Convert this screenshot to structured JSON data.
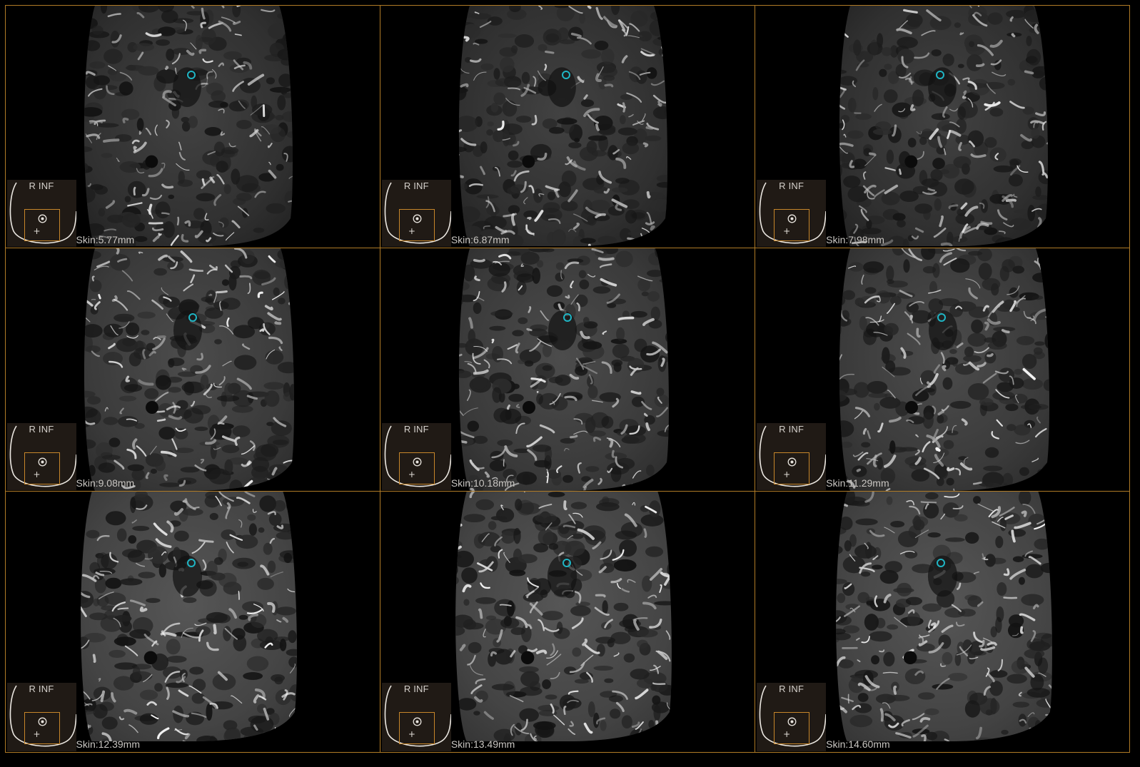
{
  "viewer": {
    "border_color": "#b07b26",
    "marker_color": "#1fb5c4",
    "tiles": [
      {
        "orientation": "R INF",
        "skin": "Skin:5.77mm"
      },
      {
        "orientation": "R INF",
        "skin": "Skin:6.87mm"
      },
      {
        "orientation": "R INF",
        "skin": "Skin:7.98mm"
      },
      {
        "orientation": "R INF",
        "skin": "Skin:9.08mm"
      },
      {
        "orientation": "R INF",
        "skin": "Skin:10.18mm"
      },
      {
        "orientation": "R INF",
        "skin": "Skin:11.29mm"
      },
      {
        "orientation": "R INF",
        "skin": "Skin:12.39mm"
      },
      {
        "orientation": "R INF",
        "skin": "Skin:13.49mm"
      },
      {
        "orientation": "R INF",
        "skin": "Skin:14.60mm"
      }
    ]
  }
}
